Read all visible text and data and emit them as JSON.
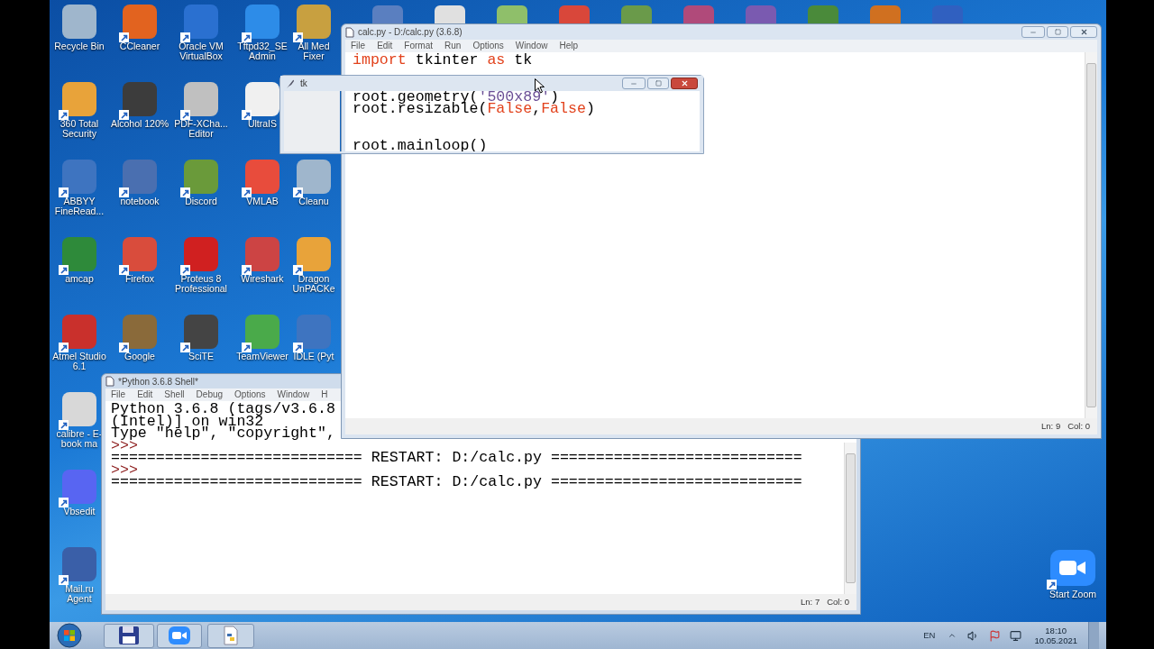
{
  "desktop": {
    "columns": [
      [
        {
          "label": "Recycle Bin",
          "shortcut": false
        },
        {
          "label": "360 Total Security",
          "shortcut": true
        },
        {
          "label": "ABBYY FineRead...",
          "shortcut": true
        },
        {
          "label": "amcap",
          "shortcut": true
        },
        {
          "label": "Atmel Studio 6.1",
          "shortcut": true
        },
        {
          "label": "calibre - E-book ma",
          "shortcut": true
        },
        {
          "label": "Vbsedit",
          "shortcut": true
        },
        {
          "label": "Mail.ru Agent",
          "shortcut": true
        }
      ],
      [
        {
          "label": "CCleaner",
          "shortcut": true
        },
        {
          "label": "Alcohol 120%",
          "shortcut": true
        },
        {
          "label": "notebook",
          "shortcut": true
        },
        {
          "label": "Firefox",
          "shortcut": true
        },
        {
          "label": "Google",
          "shortcut": true
        }
      ],
      [
        {
          "label": "Oracle VM VirtualBox",
          "shortcut": true
        },
        {
          "label": "PDF-XCha... Editor",
          "shortcut": true
        },
        {
          "label": "Discord",
          "shortcut": true
        },
        {
          "label": "Proteus 8 Professional",
          "shortcut": true
        },
        {
          "label": "SciTE",
          "shortcut": true
        }
      ],
      [
        {
          "label": "Tftpd32_SE Admin",
          "shortcut": true
        },
        {
          "label": "UltraIS",
          "shortcut": true
        },
        {
          "label": "VMLAB",
          "shortcut": true
        },
        {
          "label": "Wireshark",
          "shortcut": true
        },
        {
          "label": "TeamViewer",
          "shortcut": true
        }
      ],
      [
        {
          "label": "All Med Fixer",
          "shortcut": true
        },
        {
          "label": "Cleanu",
          "shortcut": true
        },
        {
          "label": "Dragon UnPACKe",
          "shortcut": true
        },
        {
          "label": "IDLE (Pyt",
          "shortcut": true
        }
      ]
    ],
    "start_zoom": {
      "label": "Start Zoom",
      "shortcut": true
    }
  },
  "editor": {
    "title": "calc.py - D:/calc.py (3.6.8)",
    "menu": [
      "File",
      "Edit",
      "Format",
      "Run",
      "Options",
      "Window",
      "Help"
    ],
    "lines": [
      {
        "tokens": [
          {
            "text": "import",
            "kind": "keyword"
          },
          {
            "text": " tkinter ",
            "kind": "plain"
          },
          {
            "text": "as",
            "kind": "keyword"
          },
          {
            "text": " tk",
            "kind": "plain"
          }
        ]
      },
      {
        "kind": "blank"
      },
      {
        "kind": "blank"
      },
      {
        "tokens": [
          {
            "text": "root.geometry(",
            "kind": "plain"
          },
          {
            "text": "'500x89'",
            "kind": "string"
          },
          {
            "text": ")",
            "kind": "plain"
          }
        ]
      },
      {
        "tokens": [
          {
            "text": "root.resizable(",
            "kind": "plain"
          },
          {
            "text": "False",
            "kind": "keyword"
          },
          {
            "text": ",",
            "kind": "plain"
          },
          {
            "text": "False",
            "kind": "keyword"
          },
          {
            "text": ")",
            "kind": "plain"
          }
        ]
      },
      {
        "kind": "blank"
      },
      {
        "kind": "blank"
      },
      {
        "tokens": [
          {
            "text": "root.mainloop()",
            "kind": "plain"
          }
        ]
      }
    ],
    "status": [
      "Ln: 9",
      "Col: 0"
    ]
  },
  "tk_window": {
    "title": "tk"
  },
  "shell": {
    "title": "*Python 3.6.8 Shell*",
    "menu": [
      "File",
      "Edit",
      "Shell",
      "Debug",
      "Options",
      "Window",
      "H"
    ],
    "lines": [
      {
        "kind": "output",
        "text": "Python 3.6.8 (tags/v3.6.8"
      },
      {
        "kind": "output",
        "text": "(Intel)] on win32"
      },
      {
        "kind": "output",
        "text": "Type \"help\", \"copyright\","
      },
      {
        "kind": "prompt",
        "text": ">>>"
      },
      {
        "kind": "output",
        "text": "============================ RESTART: D:/calc.py ============================"
      },
      {
        "kind": "prompt",
        "text": ">>>"
      },
      {
        "kind": "output",
        "text": "============================ RESTART: D:/calc.py ============================"
      }
    ],
    "status": [
      "Ln: 7",
      "Col: 0"
    ]
  },
  "taskbar": {
    "language": "EN",
    "time": "18:10",
    "date": "10.05.2021"
  }
}
